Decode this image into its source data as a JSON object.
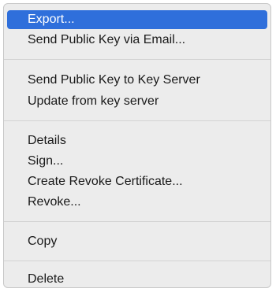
{
  "menu": {
    "items": [
      {
        "label": "Export...",
        "selected": true
      },
      {
        "label": "Send Public Key via Email..."
      },
      {
        "label": "Send Public Key to Key Server"
      },
      {
        "label": "Update from key server"
      },
      {
        "label": "Details"
      },
      {
        "label": "Sign..."
      },
      {
        "label": "Create Revoke Certificate..."
      },
      {
        "label": "Revoke..."
      },
      {
        "label": "Copy"
      },
      {
        "label": "Delete"
      }
    ]
  }
}
